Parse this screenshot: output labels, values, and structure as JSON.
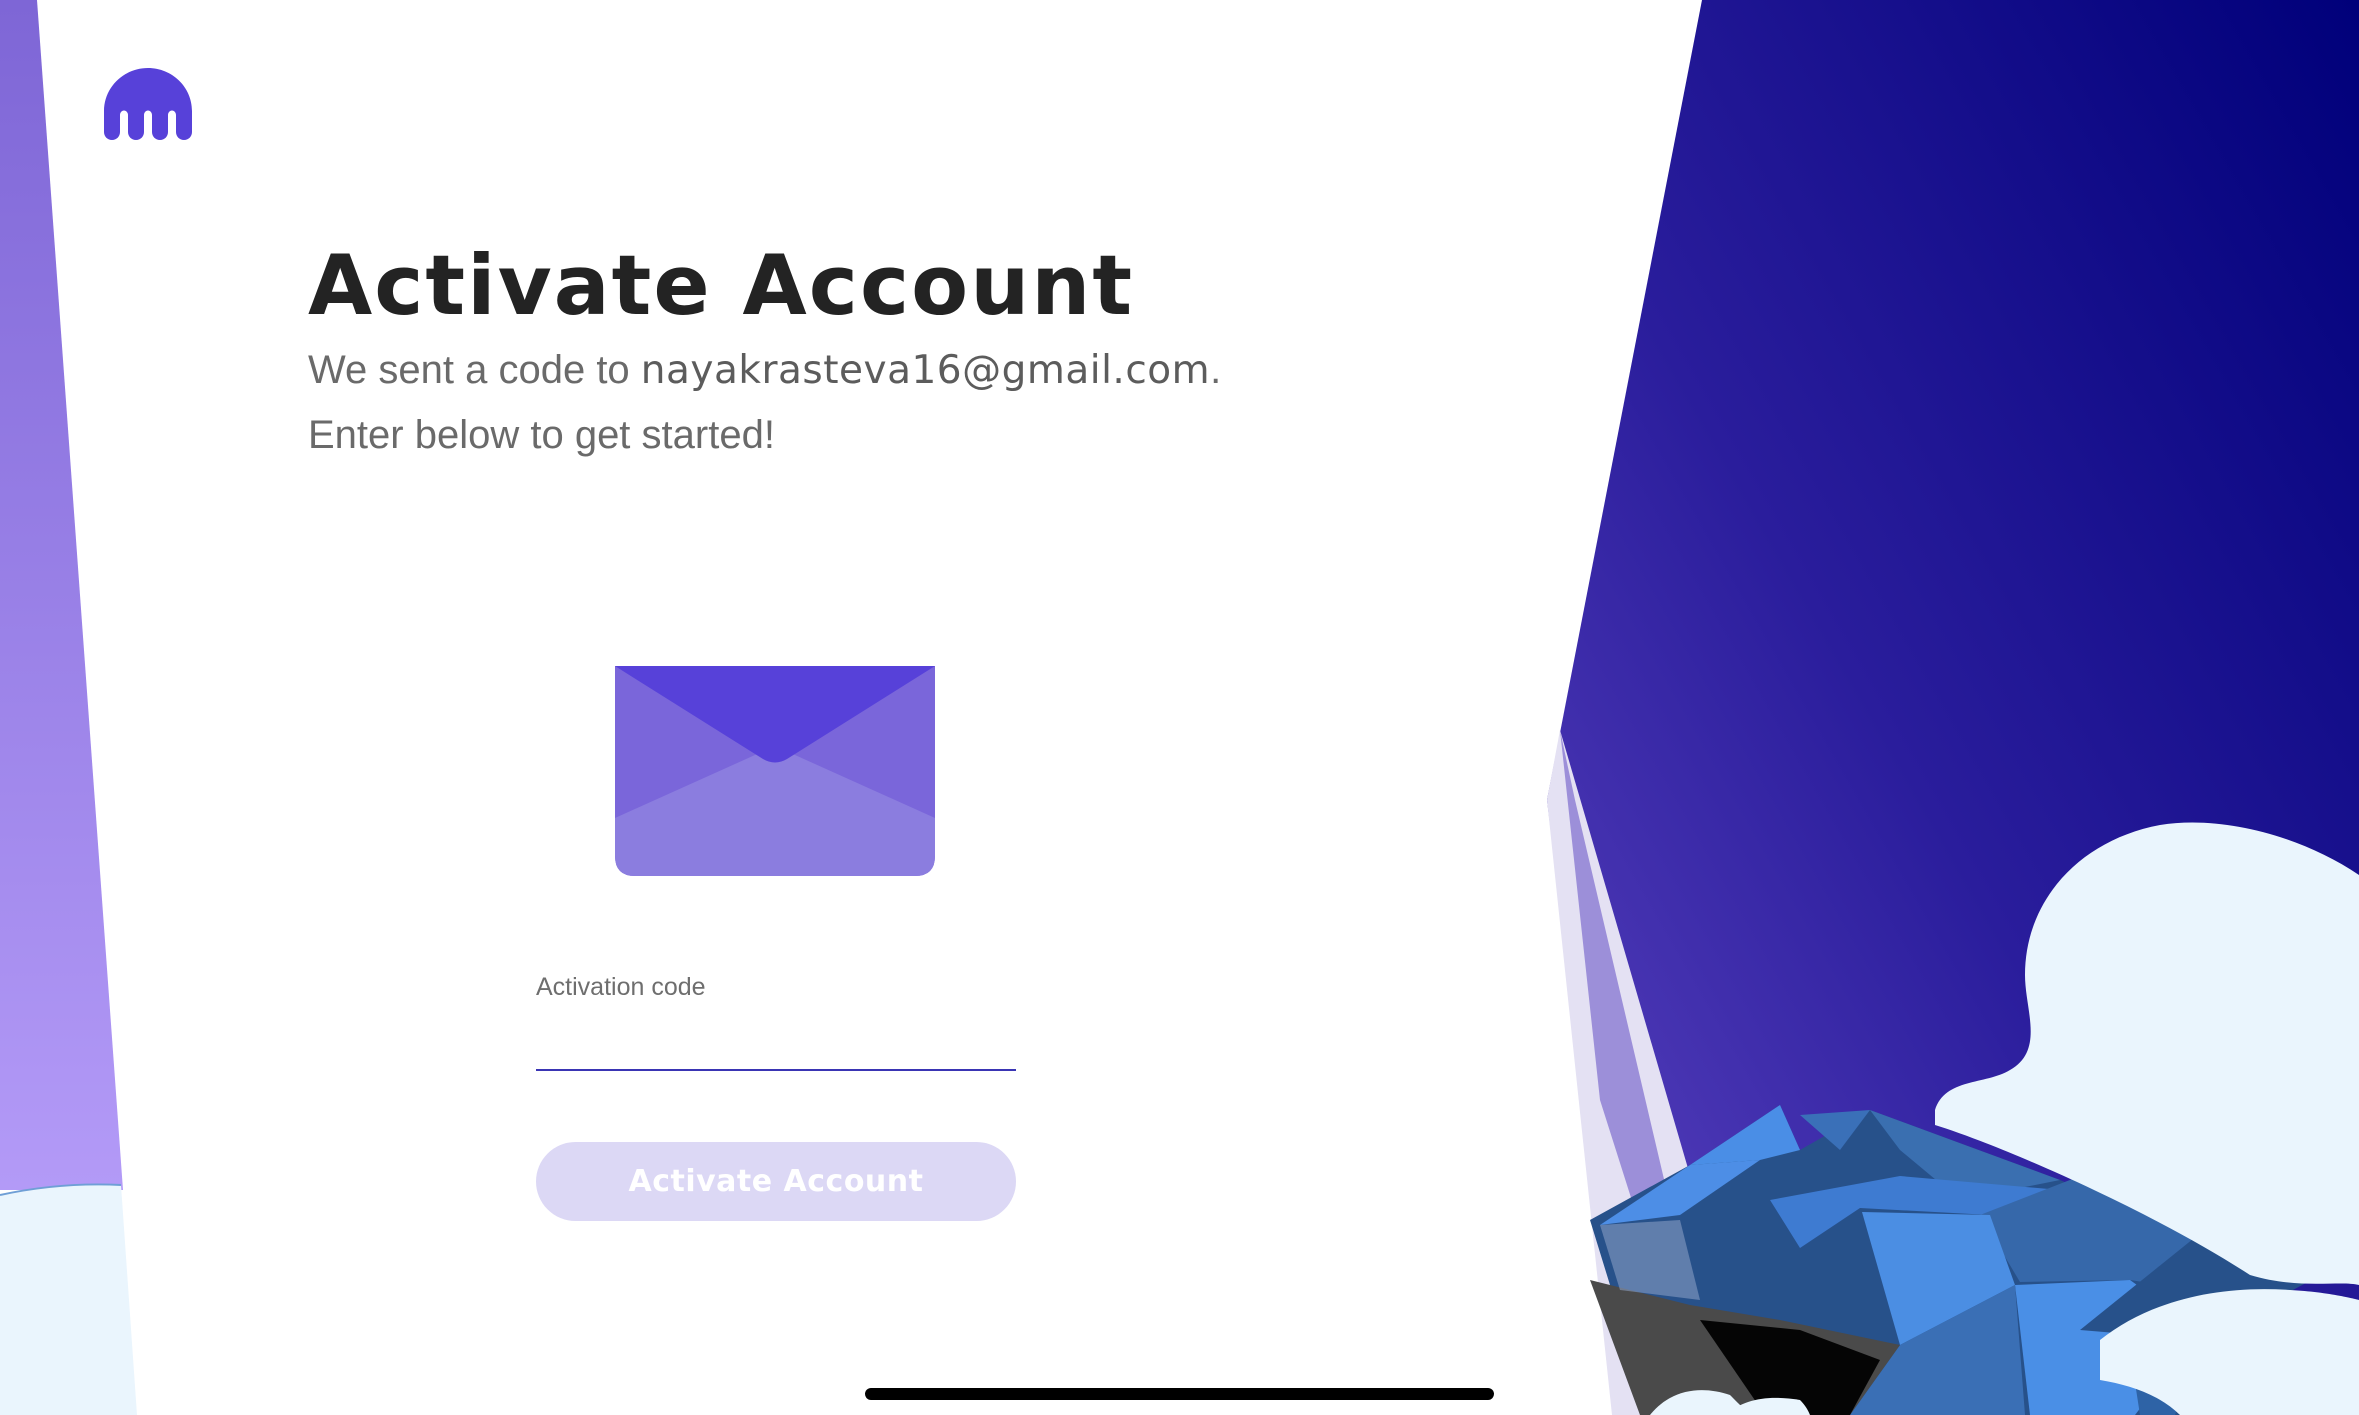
{
  "brand": {
    "logo_icon": "kraken-logo-icon",
    "color": "#5741d9"
  },
  "heading": {
    "title": "Activate Account",
    "subtitle_prefix": "We sent a code to ",
    "email": "nayakrasteva16@gmail.com",
    "subtitle_suffix": ".",
    "subtitle_line2": "Enter below to get started!"
  },
  "illustration": {
    "icon": "envelope-icon"
  },
  "form": {
    "field_label": "Activation code",
    "field_value": "",
    "submit_label": "Activate Account"
  },
  "colors": {
    "accent": "#5741d9",
    "title_text": "#232323",
    "body_text": "#6a6a6a",
    "button_disabled_bg": "#dcd8f5",
    "input_underline": "#3a35b4",
    "night_sky_top": "#02027a",
    "night_sky_bottom": "#5a3fc0",
    "cloud": "#eaf5fd"
  }
}
